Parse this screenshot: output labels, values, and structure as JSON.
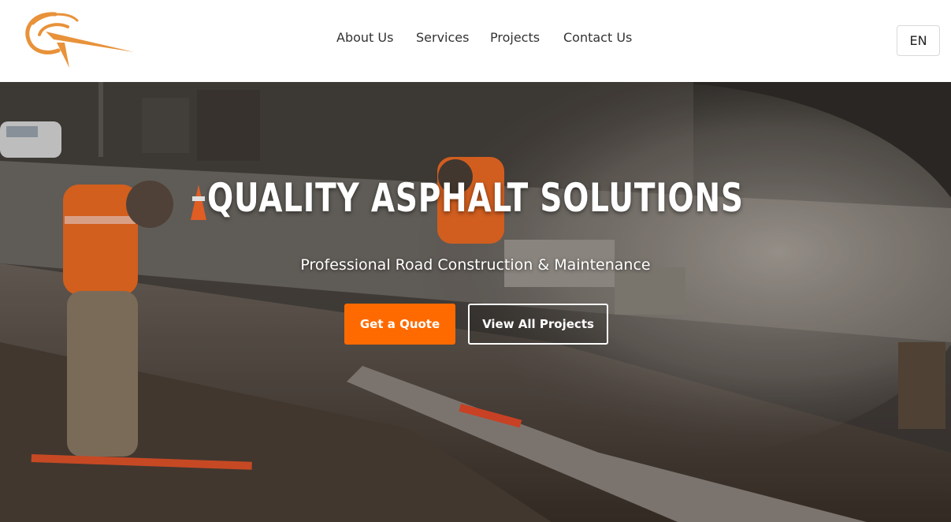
{
  "header": {
    "logo_icon": "orbit-swoosh-logo",
    "nav": {
      "about": "About Us",
      "services": "Services",
      "projects": "Projects",
      "contact": "Contact Us"
    },
    "language": "EN"
  },
  "hero": {
    "title": "QUALITY ASPHALT SOLUTIONS",
    "subtitle": "Professional Road Construction & Maintenance",
    "primary_button": "Get a Quote",
    "secondary_button": "View All Projects",
    "background": "photo of workers laying curb stones with dust cloud"
  },
  "colors": {
    "accent": "#ff6a00",
    "logo": "#e8923a",
    "nav_text": "#333333"
  }
}
